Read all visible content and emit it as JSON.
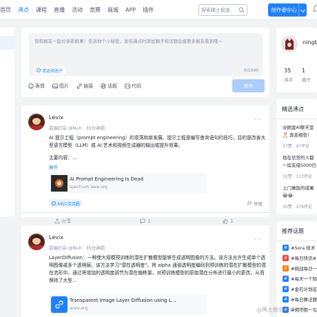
{
  "header": {
    "nav": [
      "首页",
      "沸点",
      "课程",
      "直播",
      "活动",
      "竞赛",
      "商城",
      "APP",
      "插件"
    ],
    "active_nav_index": 1,
    "search_placeholder": "探索稀土掘金",
    "creator_button": "创作者中心"
  },
  "composer": {
    "placeholder": "快和掘友一起分享新鲜事！告诉你个小秘密，发布沸点时添加圈子和话题会被更多掘友看到哦～",
    "circle_chip": "请选择圈子",
    "counter": "0/1000",
    "tools": [
      "表情",
      "图片",
      "链接",
      "话题",
      "代码"
    ],
    "publish": "发布"
  },
  "posts": [
    {
      "author": "Levix",
      "meta": "前端打杂 @Null · 35分钟前",
      "content": "AI 提示工程（prompt engineering）的衰落和新发展。提示工程是编写查询语句的技巧，目的是改善大型语言模型（LLM）或 AI 艺术和视频生成器的输出或提升效果。",
      "content2": "主要内容：...",
      "expand": "展开",
      "link_title": "AI Prompt Engineering Is Dead",
      "link_url": "spectrum.ieee.org",
      "topic": "AIGC交流圈",
      "report": "举报",
      "actions": [
        "分享",
        "1",
        "1"
      ]
    },
    {
      "author": "Levix",
      "meta": "前端打杂 @Null · 35分钟前",
      "content": "LayerDiffusion：一种使大规模预训练的潜在扩散模型能够生成透明图像的方法。该方法允许生成单个透明图像或多个透明层。该方法学习\"潜在透明度\"，将 alpha 通道透明度编码到预训练的潜在扩散模型的潜在流形中。通过将增加的透明度调节为潜在偏移量，对预训练模型的原始潜在分布进行最小的更改，从而保持了大型...",
      "link_title": "Transparent Image Layer Diffusion using L...",
      "link_url": "arxiv.org"
    }
  ],
  "profile": {
    "name": "ningbo",
    "stats": [
      {
        "num": "35",
        "label": "沸点"
      },
      {
        "num": "1",
        "label": "圈子"
      }
    ]
  },
  "featured": {
    "title": "精选沸点",
    "items": [
      {
        "text": "@掘金AI聊天室",
        "text2": "🎅 奔走相告！",
        "meta": "37赞 · 47评论"
      },
      {
        "text": "现在信贷的人都",
        "text2": "一房友借5000已",
        "meta": "32赞 · 113评论"
      },
      {
        "text": "上门做饭的成果",
        "text2": "😂😂",
        "meta": "35赞 · 179评论"
      }
    ]
  },
  "topics": {
    "title": "推荐话题",
    "items": [
      "#Sora 技术",
      "#每日快讯#",
      "#挑战每日一",
      "#每天一个知",
      "#金石计划征文",
      "#每日算法题",
      "#何不用一句"
    ]
  },
  "watermark": "@稀土掘金技术社区"
}
